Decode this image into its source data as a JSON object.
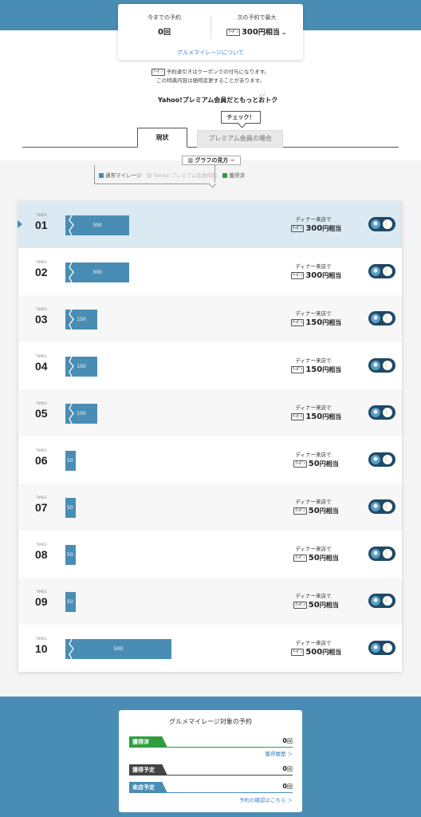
{
  "summary": {
    "left_label": "今までの予約",
    "left_value": "0",
    "left_unit": "回",
    "right_label": "次の予約で最大",
    "right_badge": "ｸｰﾎﾟﾝ",
    "right_value": "300",
    "right_unit": "円相当",
    "link": "グルメマイレージについて"
  },
  "notes": {
    "line1_badge": "ｸｰﾎﾟﾝ",
    "line1": "予約達引きはクーポンでの付与になります。",
    "line2": "この特典内容は随時変更することがあります。"
  },
  "premium": {
    "text": "Yahoo!プレミアム会員だともっとおトク",
    "check_label": "チェック！"
  },
  "tabs": [
    {
      "label": "現状"
    },
    {
      "label": "プレミアム会員の場合"
    }
  ],
  "graph": {
    "button_label": "グラフの見方",
    "legend": [
      {
        "label": "通常マイレージ",
        "color": "#4a8db4"
      },
      {
        "label": "Yahoo!プレミアム会員特典",
        "color": "#dddddd"
      },
      {
        "label": "獲得済",
        "color": "#2e9e3c"
      }
    ]
  },
  "times_label": "TIMES",
  "dinner_label": "ディナー来店で",
  "coupon_badge": "ｸｰﾎﾟﾝ",
  "amount_unit": "円相当",
  "reservations": [
    {
      "num": "01",
      "mileage": "300",
      "amount": "300"
    },
    {
      "num": "02",
      "mileage": "300",
      "amount": "300"
    },
    {
      "num": "03",
      "mileage": "150",
      "amount": "150"
    },
    {
      "num": "04",
      "mileage": "150",
      "amount": "150"
    },
    {
      "num": "05",
      "mileage": "150",
      "amount": "150"
    },
    {
      "num": "06",
      "mileage": "50",
      "amount": "50"
    },
    {
      "num": "07",
      "mileage": "50",
      "amount": "50"
    },
    {
      "num": "08",
      "mileage": "50",
      "amount": "50"
    },
    {
      "num": "09",
      "mileage": "50",
      "amount": "50"
    },
    {
      "num": "10",
      "mileage": "500",
      "amount": "500"
    }
  ],
  "status": {
    "title": "グルメマイレージ対象の予約",
    "rows": [
      {
        "tag": "獲得済",
        "value": "0",
        "unit": "回",
        "color": "#2e9e3c",
        "link": "獲得履歴 ＞"
      },
      {
        "tag": "獲得予定",
        "value": "0",
        "unit": "回",
        "color": "#444444",
        "link": ""
      },
      {
        "tag": "来店予定",
        "value": "0",
        "unit": "回",
        "color": "#4a8db4",
        "link": "予約の確認はこちら ＞"
      }
    ]
  }
}
